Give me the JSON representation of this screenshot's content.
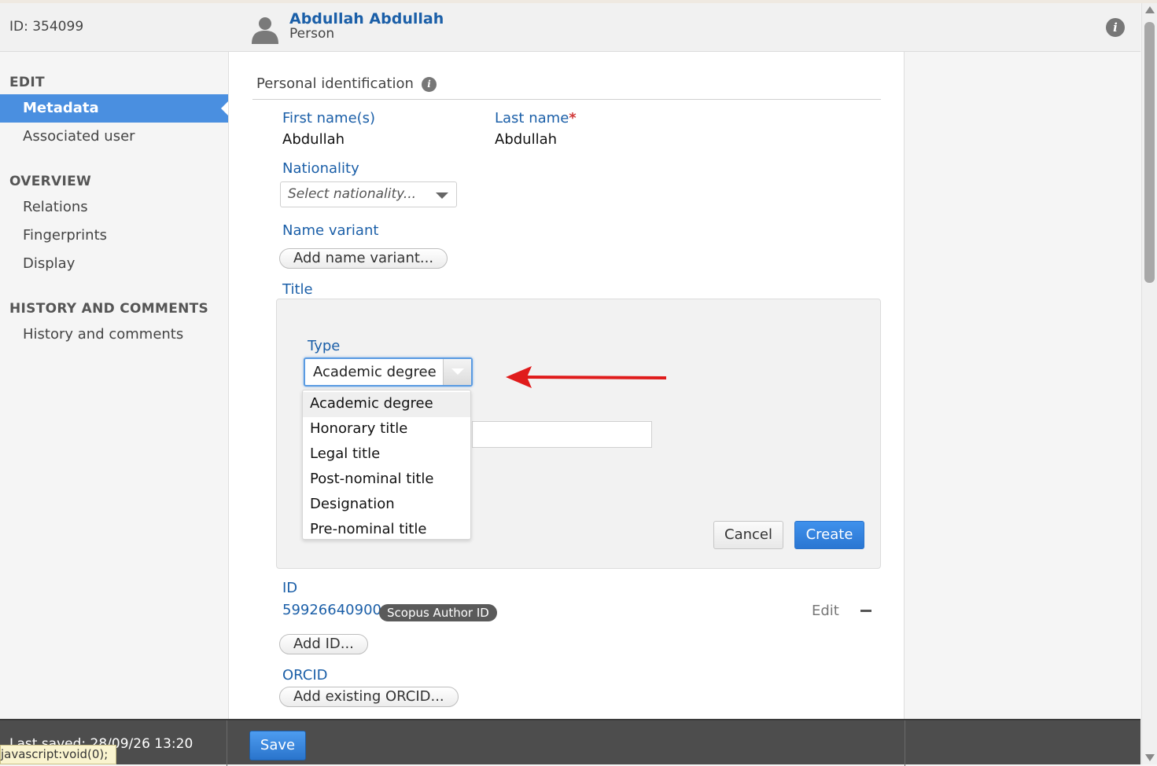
{
  "header": {
    "id_text": "ID: 354099",
    "person_name": "Abdullah Abdullah",
    "person_type": "Person",
    "avatar_icon": "user-silhouette-icon",
    "info_icon": "info-icon"
  },
  "sidebar": {
    "edit_heading": "EDIT",
    "edit_items": [
      "Metadata",
      "Associated user"
    ],
    "overview_heading": "OVERVIEW",
    "overview_items": [
      "Relations",
      "Fingerprints",
      "Display"
    ],
    "history_heading": "HISTORY AND COMMENTS",
    "history_items": [
      "History and comments"
    ]
  },
  "main": {
    "section_title": "Personal identification",
    "first_name_label": "First name(s)",
    "first_name_value": "Abdullah",
    "last_name_label": "Last name",
    "required_mark": "*",
    "last_name_value": "Abdullah",
    "nationality_label": "Nationality",
    "nationality_placeholder": "Select nationality...",
    "name_variant_label": "Name variant",
    "add_name_variant_button": "Add name variant...",
    "title_label": "Title",
    "title_panel": {
      "type_label": "Type",
      "type_selected": "Academic degree",
      "type_options": [
        "Academic degree",
        "Honorary title",
        "Legal title",
        "Post-nominal title",
        "Designation",
        "Pre-nominal title"
      ],
      "cancel_button": "Cancel",
      "create_button": "Create"
    },
    "id_label": "ID",
    "id_value": "59926640900",
    "id_badge": "Scopus Author ID",
    "id_edit": "Edit",
    "add_id_button": "Add ID...",
    "orcid_label": "ORCID",
    "add_orcid_button": "Add existing ORCID..."
  },
  "footer": {
    "last_saved": "Last saved: 28/09/26 13:20",
    "save_button": "Save",
    "status_url": "javascript:void(0);"
  },
  "colors": {
    "accent": "#4a8fe0",
    "link": "#1b5fa8",
    "annotation_arrow": "#e01b1b",
    "footer": "#4d4d4d"
  }
}
